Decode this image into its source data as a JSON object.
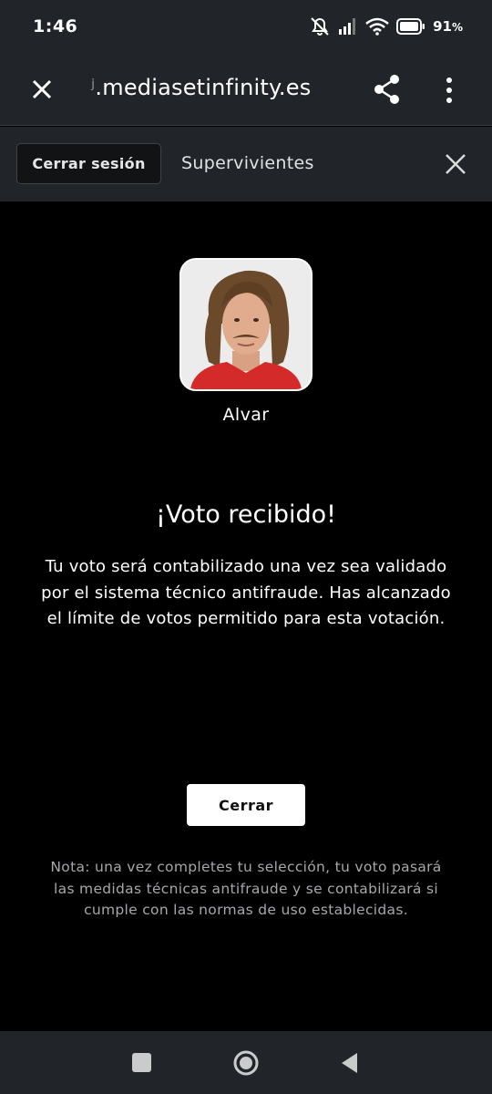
{
  "status_bar": {
    "time": "1:46",
    "battery": "91",
    "battery_unit": "%"
  },
  "browser": {
    "url_prefix": "ʲ",
    "url": ".mediasetinfinity.es"
  },
  "toolbar": {
    "logout_label": "Cerrar sesión",
    "section_title": "Supervivientes"
  },
  "contestant": {
    "name": "Alvar"
  },
  "vote": {
    "title": "¡Voto recibido!",
    "message": "Tu voto será contabilizado una vez sea validado por el sistema técnico antifraude. Has alcanzado el límite de votos permitido para esta votación.",
    "close_label": "Cerrar",
    "note": "Nota: una vez completes tu selección, tu voto pasará las medidas técnicas antifraude y se contabilizará si cumple con las normas de uso establecidas."
  },
  "colors": {
    "background": "#000000",
    "bar": "#212529",
    "accent_red": "#d42a2a"
  }
}
